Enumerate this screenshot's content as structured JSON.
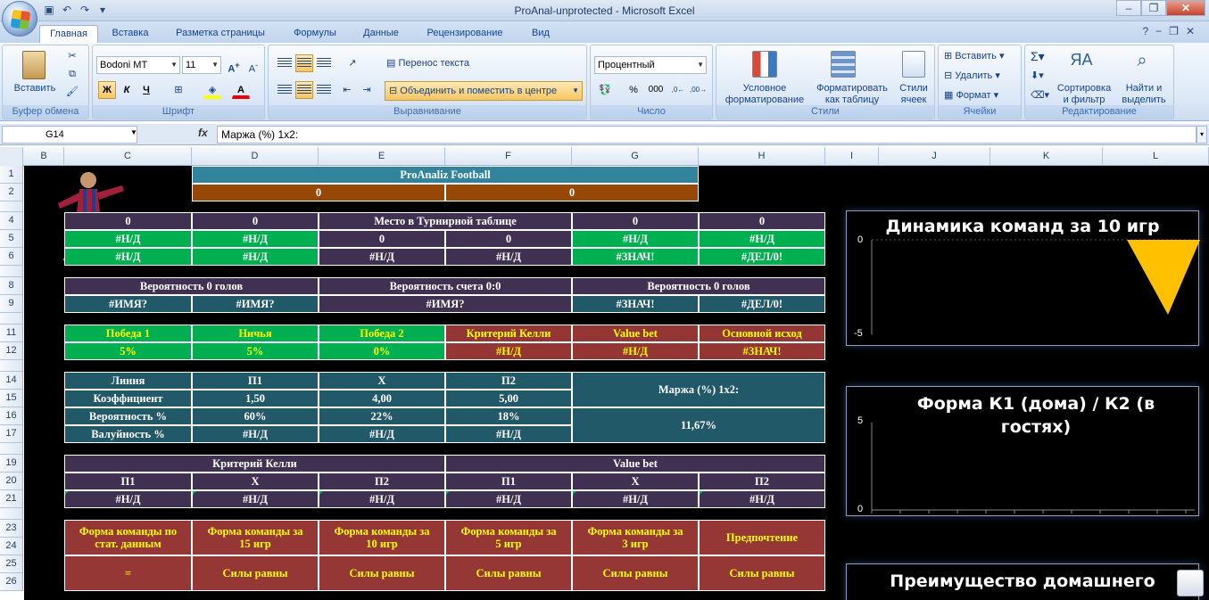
{
  "window": {
    "title": "ProAnal-unprotected  -  Microsoft Excel"
  },
  "tabs": [
    "Главная",
    "Вставка",
    "Разметка страницы",
    "Формулы",
    "Данные",
    "Рецензирование",
    "Вид"
  ],
  "ribbon": {
    "clipboard": {
      "label": "Буфер обмена",
      "paste": "Вставить"
    },
    "font": {
      "label": "Шрифт",
      "name": "Bodoni MT",
      "size": "11",
      "bold": "Ж",
      "italic": "К",
      "underline": "Ч"
    },
    "alignment": {
      "label": "Выравнивание",
      "wrap": "Перенос текста",
      "merge": "Объединить и поместить в центре"
    },
    "number": {
      "label": "Число",
      "format": "Процентный",
      "percent": "%",
      "thousands": "000"
    },
    "styles": {
      "label": "Стили",
      "conditional": "Условное форматирование",
      "as_table": "Форматировать как таблицу",
      "cell_styles": "Стили ячеек"
    },
    "cells": {
      "label": "Ячейки",
      "insert": "Вставить",
      "delete": "Удалить",
      "format": "Формат"
    },
    "editing": {
      "label": "Редактирование",
      "sort": "Сортировка и фильтр",
      "find": "Найти и выделить"
    }
  },
  "formula_bar": {
    "name_box": "G14",
    "fx": "fx",
    "formula": "Маржа (%) 1x2:"
  },
  "columns": [
    "B",
    "C",
    "D",
    "E",
    "F",
    "G",
    "H",
    "I",
    "J",
    "K",
    "L"
  ],
  "rows": [
    "1",
    "2",
    "",
    "4",
    "5",
    "6",
    "",
    "8",
    "9",
    "",
    "11",
    "12",
    "",
    "14",
    "15",
    "16",
    "17",
    "",
    "19",
    "20",
    "21",
    "",
    "23",
    "24",
    "25",
    "26"
  ],
  "sheet": {
    "header": {
      "title": "ProAnaliz Football",
      "left": "0",
      "right": "0"
    },
    "block1": {
      "r4": [
        "0",
        "0",
        "Место в Турнирной таблице",
        "0",
        "0"
      ],
      "r5": [
        "#Н/Д",
        "#Н/Д",
        "0",
        "0",
        "#Н/Д",
        "#Н/Д"
      ],
      "r6": [
        "#Н/Д",
        "#Н/Д",
        "#Н/Д",
        "#Н/Д",
        "#ЗНАЧ!",
        "#ДЕЛ/0!"
      ]
    },
    "block2": {
      "r8": [
        "Вероятность 0 голов",
        "Вероятность счета 0:0",
        "Вероятность 0 голов"
      ],
      "r9": [
        "#ИМЯ?",
        "#ИМЯ?",
        "#ИМЯ?",
        "#ЗНАЧ!",
        "#ДЕЛ/0!"
      ]
    },
    "block3": {
      "r11": [
        "Победа 1",
        "Ничья",
        "Победа 2",
        "Критерий Келли",
        "Value bet",
        "Основной исход"
      ],
      "r12": [
        "5%",
        "5%",
        "0%",
        "#Н/Д",
        "#Н/Д",
        "#ЗНАЧ!"
      ]
    },
    "block4": {
      "r14": [
        "Линия",
        "П1",
        "X",
        "П2"
      ],
      "r15": [
        "Коэффициент",
        "1,50",
        "4,00",
        "5,00"
      ],
      "r16": [
        "Вероятность %",
        "60%",
        "22%",
        "18%"
      ],
      "r17": [
        "Валуйность %",
        "#Н/Д",
        "#Н/Д",
        "#Н/Д"
      ],
      "margin_label": "Маржа (%) 1x2:",
      "margin_value": "11,67%"
    },
    "block5": {
      "r19": [
        "Критерий Келли",
        "Value bet"
      ],
      "r20": [
        "П1",
        "X",
        "П2",
        "П1",
        "X",
        "П2"
      ],
      "r21": [
        "#Н/Д",
        "#Н/Д",
        "#Н/Д",
        "#Н/Д",
        "#Н/Д",
        "#Н/Д"
      ]
    },
    "block6": {
      "r23": [
        "Форма команды по стат. данным",
        "Форма команды за 15 игр",
        "Форма команды за 10 игр",
        "Форма команды за 5 игр",
        "Форма команды за 3 игр",
        "Предпочтение"
      ],
      "r25": [
        "=",
        "Силы равны",
        "Силы равны",
        "Силы равны",
        "Силы равны",
        "Силы равны"
      ]
    }
  },
  "charts": [
    {
      "title": "Динамика команд за 10 игр",
      "ticks": [
        "0",
        "-5"
      ]
    },
    {
      "title": "Форма К1 (дома) / К2 (в гостях)",
      "ticks": [
        "5",
        "0"
      ]
    },
    {
      "title": "Преимущество домашнего",
      "ticks": []
    }
  ],
  "colors": {
    "teal": "#215968",
    "purple": "#403152",
    "green": "#00b050",
    "brown": "#974706",
    "red": "#943634",
    "steel": "#31849b",
    "yellow": "#ffff00",
    "accent_triangle": "#ffc000"
  }
}
